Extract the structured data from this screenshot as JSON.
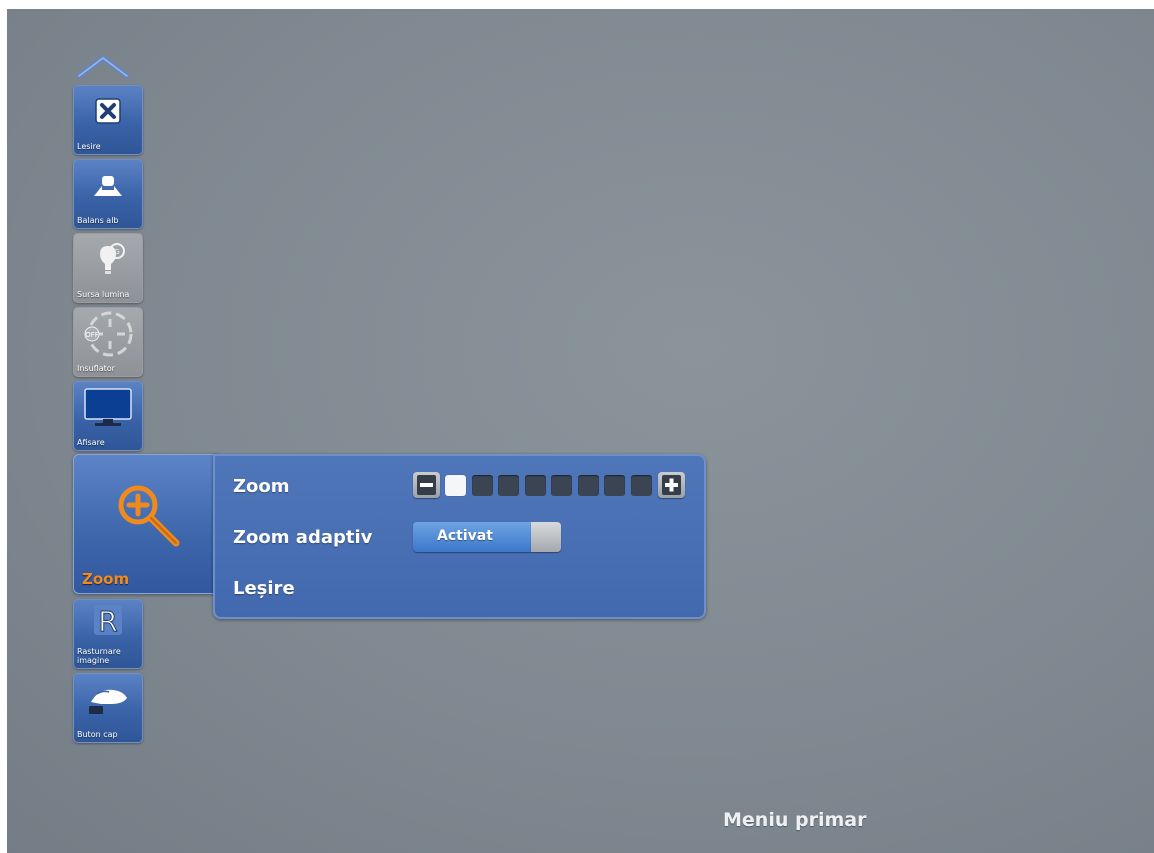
{
  "sidebar": {
    "scroll_up_icon": "chevron-up-icon",
    "items": [
      {
        "label": "Lesire",
        "icon": "close-x-icon",
        "enabled": true
      },
      {
        "label": "Balans alb",
        "icon": "white-balance-icon",
        "enabled": true
      },
      {
        "label": "Sursa lumina",
        "icon": "light-source-icon",
        "enabled": false
      },
      {
        "label": "Insuflator",
        "icon": "insufflator-icon",
        "enabled": false
      },
      {
        "label": "Afisare",
        "icon": "monitor-icon",
        "enabled": true
      },
      {
        "label": "Zoom",
        "icon": "magnifier-plus-icon",
        "enabled": true,
        "selected": true
      },
      {
        "label": "Rasturnare\nimagine",
        "icon": "r-letter-icon",
        "enabled": true
      },
      {
        "label": "Buton cap",
        "icon": "hand-button-icon",
        "enabled": true
      }
    ]
  },
  "zoom_panel": {
    "zoom": {
      "label": "Zoom",
      "level": 1,
      "max_level": 8,
      "minus_icon": "minus-icon",
      "plus_icon": "plus-icon"
    },
    "zoom_adaptive": {
      "label": "Zoom adaptiv",
      "state": "Activat"
    },
    "exit": {
      "label": "Leșire"
    }
  },
  "footer": {
    "title": "Meniu primar"
  },
  "colors": {
    "background": "#838c94",
    "tile_blue": "#3f68ad",
    "panel_blue": "#4a70b4",
    "accent_orange": "#f08a1c",
    "toggle_blue": "#4a85d2"
  }
}
